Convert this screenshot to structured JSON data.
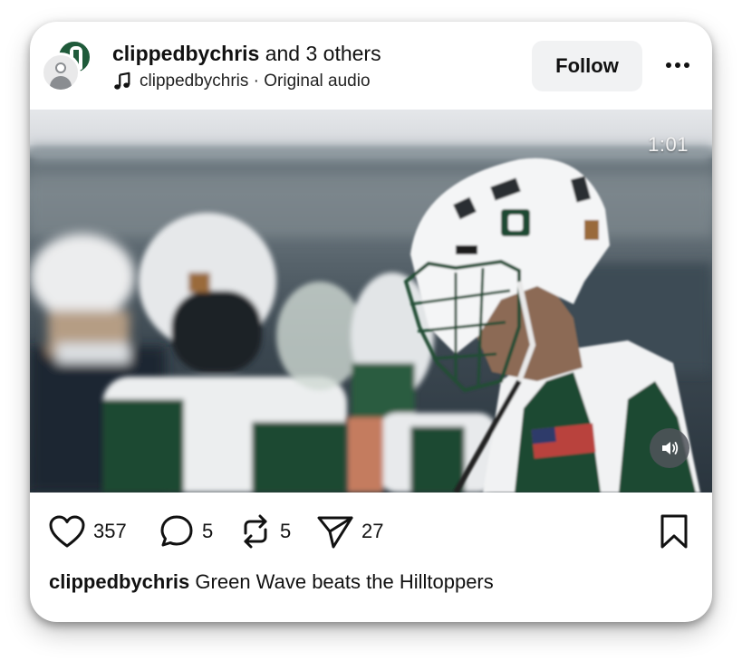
{
  "post": {
    "author": "clippedbychris",
    "coauthors_text": "and 3 others",
    "audio": {
      "icon": "music-note-icon",
      "text": "clippedbychris · Original audio"
    },
    "follow_label": "Follow",
    "more_icon": "more-options-icon",
    "media": {
      "timestamp": "1:01",
      "volume_icon": "speaker-icon"
    },
    "actions": {
      "likes": "357",
      "comments": "5",
      "reposts": "5",
      "shares": "27"
    },
    "caption": {
      "user": "clippedbychris",
      "text": "Green Wave beats the Hilltoppers"
    }
  },
  "colors": {
    "team_green": "#1f5a3a",
    "follow_bg": "#f1f2f3",
    "text": "#111111"
  }
}
